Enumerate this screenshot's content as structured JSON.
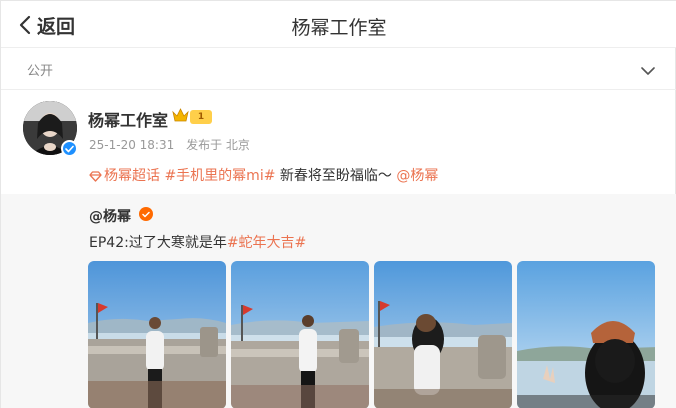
{
  "nav": {
    "back_label": "返回",
    "title": "杨幂工作室"
  },
  "visibility": {
    "label": "公开"
  },
  "post": {
    "author": "杨幂工作室",
    "level_badge": "1",
    "date": "25-1-20 18:31",
    "location": "发布于 北京",
    "tag_supertopic": "杨幂超话",
    "tag_hashtag": "#手机里的幂mi#",
    "body": " 新春将至盼福临～",
    "mention": "@杨幂"
  },
  "repost": {
    "author": "@杨幂",
    "text_prefix": "EP42:过了大寒就是年",
    "hashtag": "#蛇年大吉#",
    "photos": [
      "photo-1",
      "photo-2",
      "photo-3",
      "photo-4"
    ]
  },
  "colors": {
    "accent": "#eb7350",
    "verified_blue": "#1e90ff",
    "verified_orange": "#ff6a00"
  }
}
